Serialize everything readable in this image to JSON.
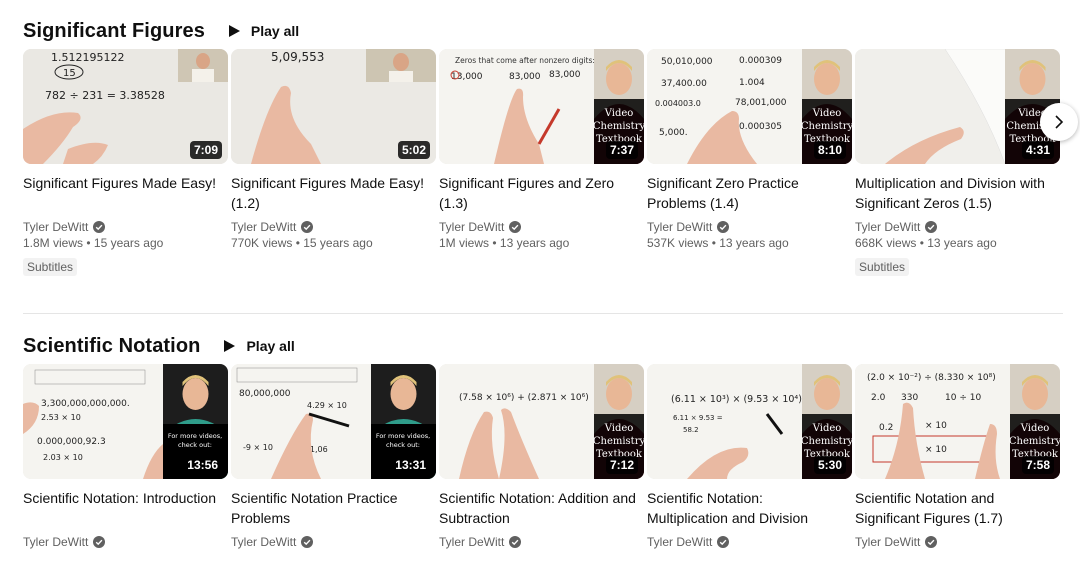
{
  "shelves": [
    {
      "title": "Significant Figures",
      "play_all": "Play all",
      "videos": [
        {
          "title": "Significant Figures Made Easy!",
          "duration": "7:09",
          "channel": "Tyler DeWitt",
          "views": "1.8M views",
          "age": "15 years ago",
          "badge": "Subtitles"
        },
        {
          "title": "Significant Figures Made Easy! (1.2)",
          "duration": "5:02",
          "channel": "Tyler DeWitt",
          "views": "770K views",
          "age": "15 years ago",
          "badge": ""
        },
        {
          "title": "Significant Figures and Zero (1.3)",
          "duration": "7:37",
          "channel": "Tyler DeWitt",
          "views": "1M views",
          "age": "13 years ago",
          "badge": ""
        },
        {
          "title": "Significant Zero Practice Problems (1.4)",
          "duration": "8:10",
          "channel": "Tyler DeWitt",
          "views": "537K views",
          "age": "13 years ago",
          "badge": ""
        },
        {
          "title": "Multiplication and Division with Significant Zeros (1.5)",
          "duration": "4:31",
          "channel": "Tyler DeWitt",
          "views": "668K views",
          "age": "13 years ago",
          "badge": "Subtitles"
        }
      ]
    },
    {
      "title": "Scientific Notation",
      "play_all": "Play all",
      "videos": [
        {
          "title": "Scientific Notation: Introduction",
          "duration": "13:56",
          "channel": "Tyler DeWitt"
        },
        {
          "title": "Scientific Notation Practice Problems",
          "duration": "13:31",
          "channel": "Tyler DeWitt"
        },
        {
          "title": "Scientific Notation: Addition and Subtraction",
          "duration": "7:12",
          "channel": "Tyler DeWitt"
        },
        {
          "title": "Scientific Notation: Multiplication and Division",
          "duration": "5:30",
          "channel": "Tyler DeWitt"
        },
        {
          "title": "Scientific Notation and Significant Figures (1.7)",
          "duration": "7:58",
          "channel": "Tyler DeWitt"
        }
      ]
    }
  ],
  "thumb_text": {
    "s0v0": [
      "1.512195122",
      "15",
      "782 ÷ 231 = 3.38528"
    ],
    "s0v1": [
      "5,09,553"
    ],
    "s0v2": [
      "Zeros that come after nonzero digits:",
      "13,000",
      "83,000",
      "83,000",
      "Video",
      "Chemistry",
      "Textbook"
    ],
    "s0v3": [
      "50,010,000",
      "0.000309",
      "37,400.00",
      "1.004",
      "0.004003.0",
      "78,001,000",
      "5,000.",
      "0.000305",
      "Video",
      "Chemistry",
      "Textbook"
    ],
    "s0v4": [
      "Video",
      "Chemistry",
      "Textbook"
    ],
    "s1v0": [
      "3,300,000,000,000.",
      "2.53 × 10",
      "0.000,000,92.3",
      "2.03 × 10",
      "For more videos,",
      "check out:"
    ],
    "s1v1": [
      "80,000,000",
      "4.29 × 10",
      "-9 × 10",
      "-1,06",
      "For more videos,",
      "check out:"
    ],
    "s1v2": [
      "(7.58 × 10⁶) + (2.871 × 10⁶)",
      "Video",
      "Chemistry",
      "Textbook"
    ],
    "s1v3": [
      "(6.11 × 10³) × (9.53 × 10⁴)",
      "6.11 × 9.53 =",
      "58.2",
      "Video",
      "Chemistry",
      "Textbook"
    ],
    "s1v4": [
      "(2.0 × 10⁻²) ÷ (8.330 × 10⁸)",
      "2.0",
      "330",
      "10 ÷ 10",
      "0.2",
      "× 10",
      "× 10",
      "Video",
      "Chemistry",
      "Textbook"
    ]
  },
  "colors": {
    "accent_red": "#c5392b",
    "text_primary": "#0f0f0f",
    "text_secondary": "#606060"
  },
  "icons": {
    "play": "play-icon",
    "verified": "verified-check-icon",
    "next": "chevron-right-icon"
  }
}
